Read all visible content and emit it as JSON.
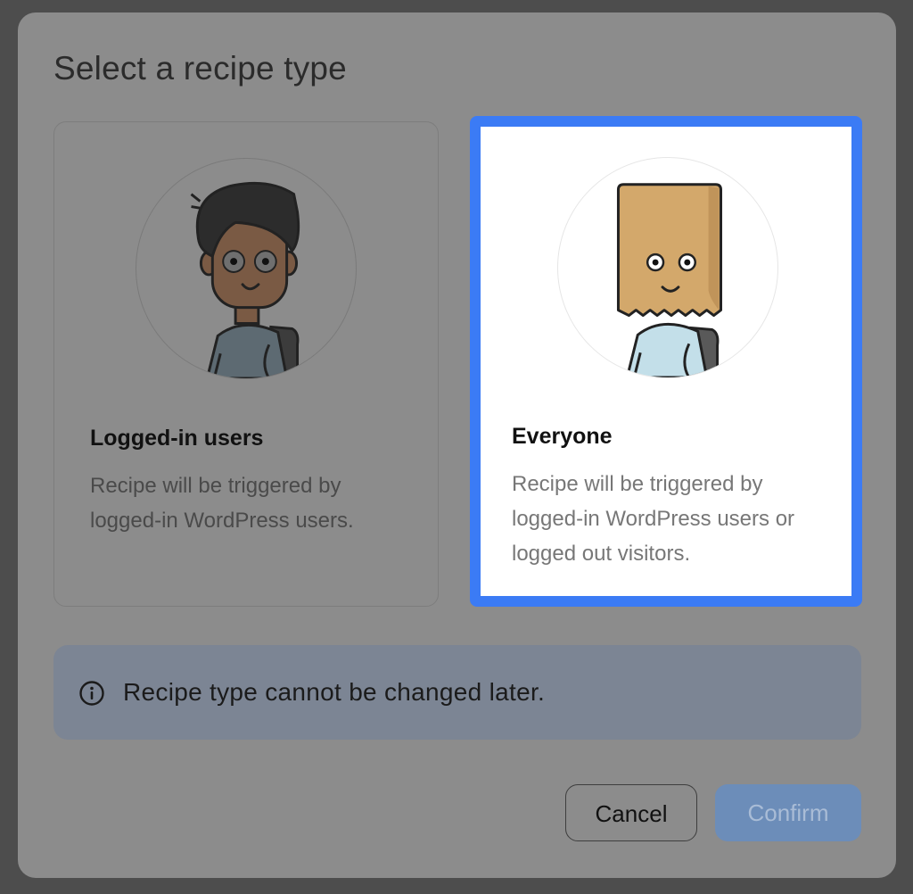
{
  "dialog": {
    "title": "Select a recipe type"
  },
  "options": [
    {
      "title": "Logged-in users",
      "description": "Recipe will be triggered by logged-in WordPress users.",
      "avatar_icon": "person-icon",
      "selected": false
    },
    {
      "title": "Everyone",
      "description": "Recipe will be triggered by logged-in WordPress users or logged out visitors.",
      "avatar_icon": "paper-bag-head-person-icon",
      "selected": true
    }
  ],
  "info": {
    "icon": "info-icon",
    "text": "Recipe type cannot be changed later."
  },
  "buttons": {
    "cancel_label": "Cancel",
    "confirm_label": "Confirm"
  },
  "colors": {
    "selection_border": "#3b7bf5",
    "confirm_button": "#6c8db9",
    "info_banner": "#7c8594"
  }
}
